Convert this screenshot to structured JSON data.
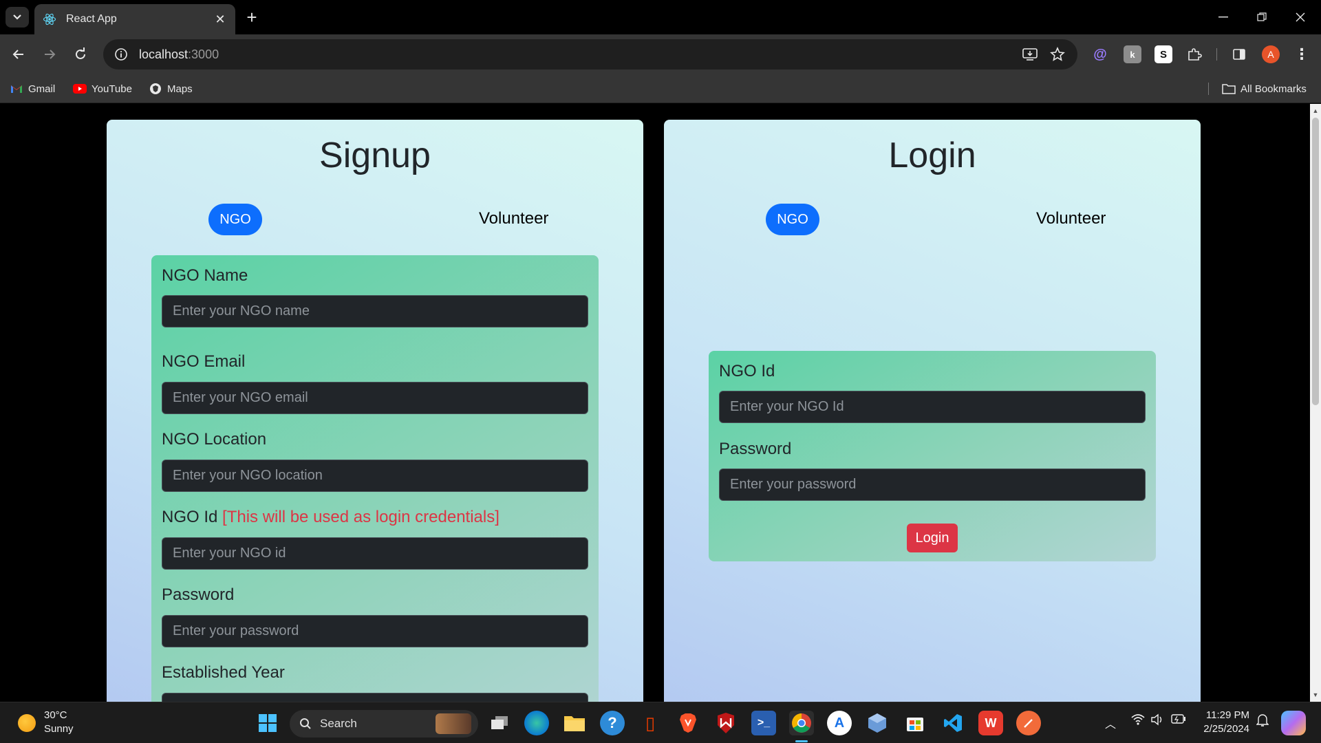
{
  "browser": {
    "tab_title": "React App",
    "url_host": "localhost",
    "url_port": ":3000",
    "profile_initial": "A",
    "bookmarks": [
      {
        "label": "Gmail",
        "icon": "gmail-icon"
      },
      {
        "label": "YouTube",
        "icon": "youtube-icon"
      },
      {
        "label": "Maps",
        "icon": "maps-icon"
      }
    ],
    "all_bookmarks_label": "All Bookmarks"
  },
  "signup": {
    "title": "Signup",
    "tabs": {
      "ngo": "NGO",
      "volunteer": "Volunteer"
    },
    "fields": {
      "name_label": "NGO Name",
      "name_placeholder": "Enter your NGO name",
      "email_label": "NGO Email",
      "email_placeholder": "Enter your NGO email",
      "location_label": "NGO Location",
      "location_placeholder": "Enter your NGO location",
      "id_label": "NGO Id",
      "id_note": "[This will be used as login credentials]",
      "id_placeholder": "Enter your NGO id",
      "password_label": "Password",
      "password_placeholder": "Enter your password",
      "year_label": "Established Year"
    }
  },
  "login": {
    "title": "Login",
    "tabs": {
      "ngo": "NGO",
      "volunteer": "Volunteer"
    },
    "fields": {
      "id_label": "NGO Id",
      "id_placeholder": "Enter your NGO Id",
      "password_label": "Password",
      "password_placeholder": "Enter your password"
    },
    "button": "Login"
  },
  "taskbar": {
    "weather_temp": "30°C",
    "weather_desc": "Sunny",
    "search_label": "Search",
    "time": "11:29 PM",
    "date": "2/25/2024"
  },
  "colors": {
    "primary": "#0d6efd",
    "danger": "#dc3545"
  }
}
